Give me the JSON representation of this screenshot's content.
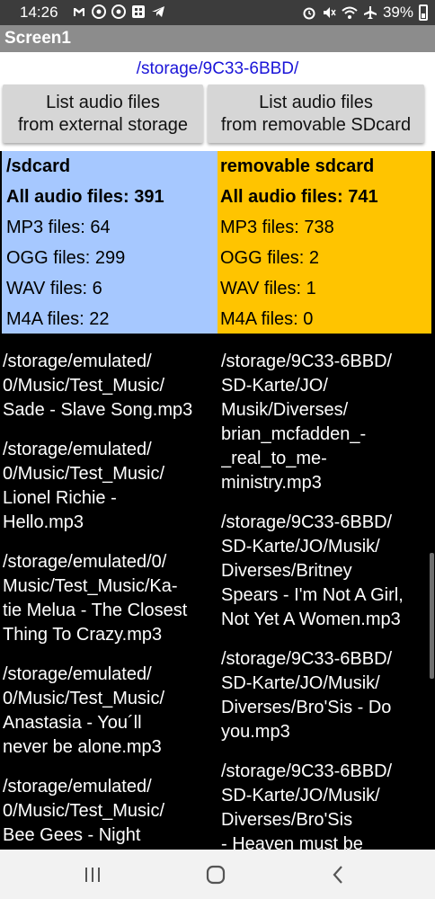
{
  "status_bar": {
    "time": "14:26",
    "battery": "39%",
    "left_icons": [
      "gmail-icon",
      "chrome-icon",
      "chrome-icon",
      "app-grid-icon",
      "telegram-icon"
    ],
    "right_icons": [
      "alarm-icon",
      "mute-icon",
      "wifi-icon",
      "airplane-icon",
      "battery-icon"
    ]
  },
  "app": {
    "title": "Screen1",
    "path": "/storage/9C33-6BBD/"
  },
  "buttons": {
    "external": "List audio files\nfrom external storage",
    "removable": "List audio files\nfrom removable SDcard"
  },
  "left_stats": {
    "title": "/sdcard",
    "all": "All audio files: 391",
    "mp3": "MP3 files: 64",
    "ogg": "OGG files: 299",
    "wav": "WAV files: 6",
    "m4a": "M4A files: 22"
  },
  "right_stats": {
    "title": "removable sdcard",
    "all": "All audio files: 741",
    "mp3": "MP3 files: 738",
    "ogg": "OGG files: 2",
    "wav": "WAV files: 1",
    "m4a": "M4A files: 0"
  },
  "left_files": [
    "/storage/emulated/\n0/Music/Test_Music/\nSade - Slave Song.mp3",
    "/storage/emulated/\n0/Music/Test_Music/\nLionel Richie -\nHello.mp3",
    "/storage/emulated/0/\nMusic/Test_Music/Ka-\ntie Melua - The Closest\nThing To Crazy.mp3",
    "/storage/emulated/\n0/Music/Test_Music/\nAnastasia - You´ll\nnever be alone.mp3",
    "/storage/emulated/\n0/Music/Test_Music/\nBee Gees - Night"
  ],
  "right_files": [
    "/storage/9C33-6BBD/\nSD-Karte/JO/\nMusik/Diverses/\nbrian_mcfadden_-\n_real_to_me-\nministry.mp3",
    "/storage/9C33-6BBD/\nSD-Karte/JO/Musik/\nDiverses/Britney\nSpears - I'm Not A Girl,\nNot Yet A Women.mp3",
    "/storage/9C33-6BBD/\nSD-Karte/JO/Musik/\nDiverses/Bro'Sis - Do\nyou.mp3",
    "/storage/9C33-6BBD/\nSD-Karte/JO/Musik/\nDiverses/Bro'Sis\n- Heaven must be"
  ],
  "colors": {
    "left_panel": "#a6c8ff",
    "right_panel": "#ffc400",
    "path_text": "#1a14d8"
  }
}
